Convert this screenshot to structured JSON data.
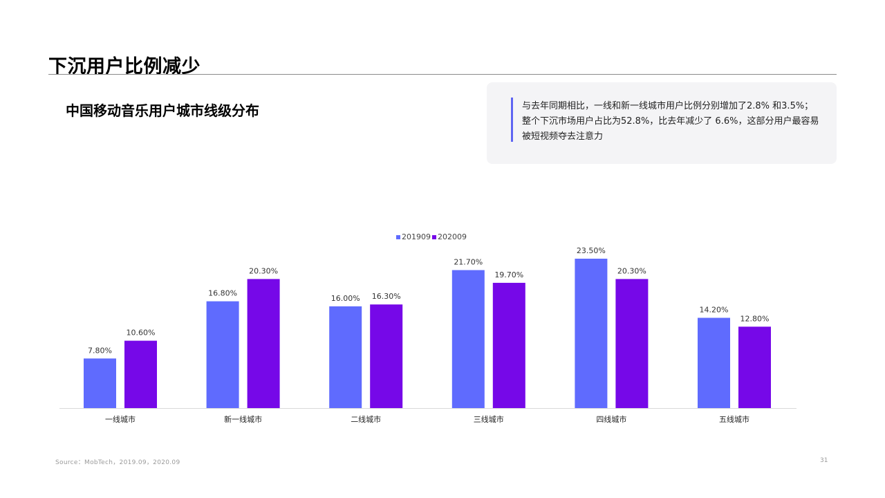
{
  "page": {
    "title": "下沉用户比例减少",
    "number": "31"
  },
  "section": {
    "title": "中国移动音乐用户城市线级分布"
  },
  "summary": {
    "lines": [
      "与去年同期相比，一线和新一线城市用户比例分别增加了2.8% 和3.5%；",
      "整个下沉市场用户占比为52.8%，比去年减少了 6.6%，这部分用户最容易",
      "被短视频夺去注意力"
    ],
    "accent_color": "#5e64f2"
  },
  "footer": {
    "source": "Source：MobTech，2019.09，2020.09"
  },
  "chart_data": {
    "type": "bar",
    "categories": [
      "一线城市",
      "新一线城市",
      "二线城市",
      "三线城市",
      "四线城市",
      "五线城市"
    ],
    "series": [
      {
        "name": "201909",
        "color": "#5f6bfe",
        "values": [
          7.8,
          16.8,
          16.0,
          21.7,
          23.5,
          14.2
        ],
        "labels": [
          "7.80%",
          "16.80%",
          "16.00%",
          "21.70%",
          "23.50%",
          "14.20%"
        ]
      },
      {
        "name": "202009",
        "color": "#7608e8",
        "values": [
          10.6,
          20.3,
          16.3,
          19.7,
          20.3,
          12.8
        ],
        "labels": [
          "10.60%",
          "20.30%",
          "16.30%",
          "19.70%",
          "20.30%",
          "12.80%"
        ]
      }
    ],
    "ylim": [
      0,
      25
    ],
    "legend_position": "top-center",
    "grid": false
  }
}
